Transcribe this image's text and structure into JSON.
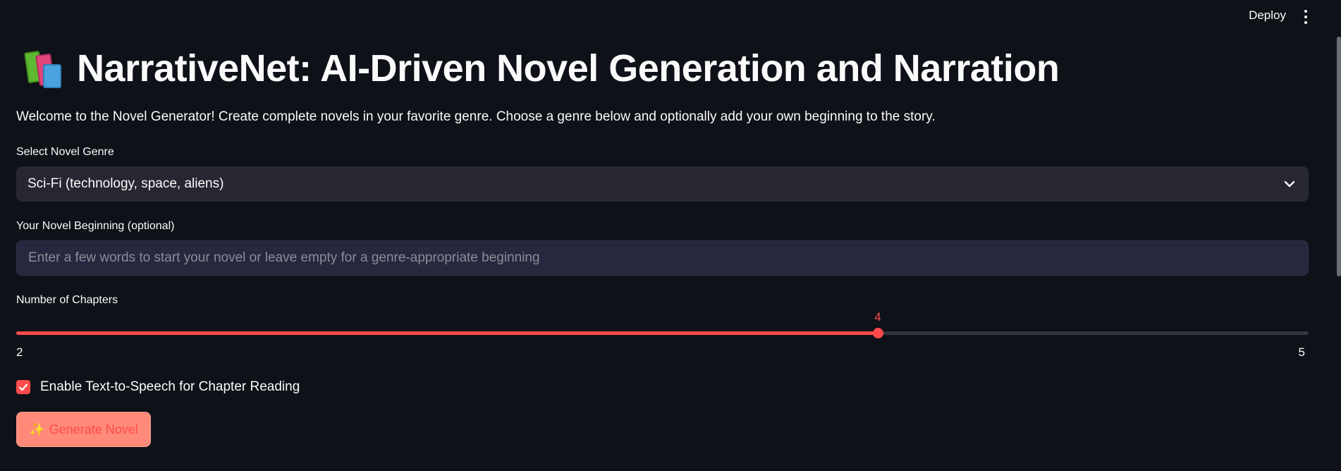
{
  "header": {
    "deploy_label": "Deploy",
    "menu_icon": "kebab-menu-icon"
  },
  "page": {
    "title_icon": "books-icon",
    "title": "NarrativeNet: AI-Driven Novel Generation and Narration",
    "intro": "Welcome to the Novel Generator! Create complete novels in your favorite genre. Choose a genre below and optionally add your own beginning to the story."
  },
  "genre": {
    "label": "Select Novel Genre",
    "selected": "Sci-Fi (technology, space, aliens)"
  },
  "beginning": {
    "label": "Your Novel Beginning (optional)",
    "value": "",
    "placeholder": "Enter a few words to start your novel or leave empty for a genre-appropriate beginning"
  },
  "chapters": {
    "label": "Number of Chapters",
    "min": 2,
    "max": 5,
    "value": 4,
    "min_label": "2",
    "max_label": "5",
    "value_label": "4"
  },
  "tts": {
    "label": "Enable Text-to-Speech for Chapter Reading",
    "checked": true
  },
  "generate": {
    "icon": "sparkle-icon",
    "label": "Generate Novel"
  },
  "colors": {
    "background": "#0e1117",
    "accent": "#ff4b4b",
    "input_bg": "#262730"
  }
}
